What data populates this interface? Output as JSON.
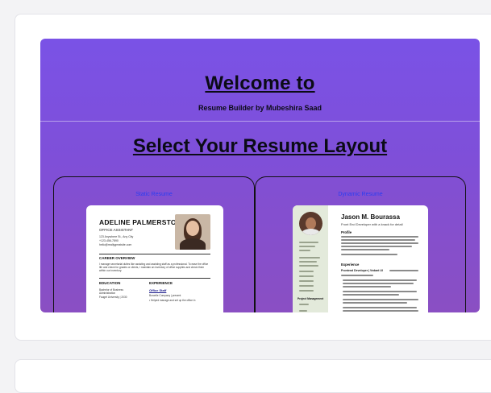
{
  "hero": {
    "welcome": "Welcome to",
    "subtitle": "Resume Builder by Mubeshira Saad",
    "layout_title": "Select Your Resume Layout"
  },
  "layouts": [
    {
      "label": "Static Resume",
      "preview": {
        "name": "ADELINE PALMERSTON",
        "role": "OFFICE ASSISTANT",
        "contact": [
          "123 Anywhere St., Any City",
          "+123-456-7890",
          "hello@reallygreatsite.com"
        ],
        "overview_title": "CAREER OVERVIEW",
        "overview_text": "I manage secretarial duties like assisting and assisting staff as a professional. To ease the office life and check for grades or clients, I maintain an inventory of office supplies and check them within our inventory.",
        "education_title": "EDUCATION",
        "education_lines": [
          "Bachelor of Business",
          "Administration",
          "Fauget University | 2030"
        ],
        "experience_title": "EXPERIENCE",
        "experience_role": "Office Staff",
        "experience_lines": [
          "Borcelle Company | present",
          "• Helped manage and set up the office in"
        ]
      }
    },
    {
      "label": "Dynamic Resume",
      "preview": {
        "name": "Jason M. Bourassa",
        "tagline": "Front End Developer with a knack for detail",
        "profile_title": "Profile",
        "experience_title": "Experience",
        "experience_role": "Frontend Developer | Vedant UI",
        "side_section": "Project Management"
      }
    }
  ],
  "colors": {
    "gradient_top": "#7a52e6",
    "gradient_bottom": "#8a4fc2",
    "label_blue": "#2a3df0"
  }
}
